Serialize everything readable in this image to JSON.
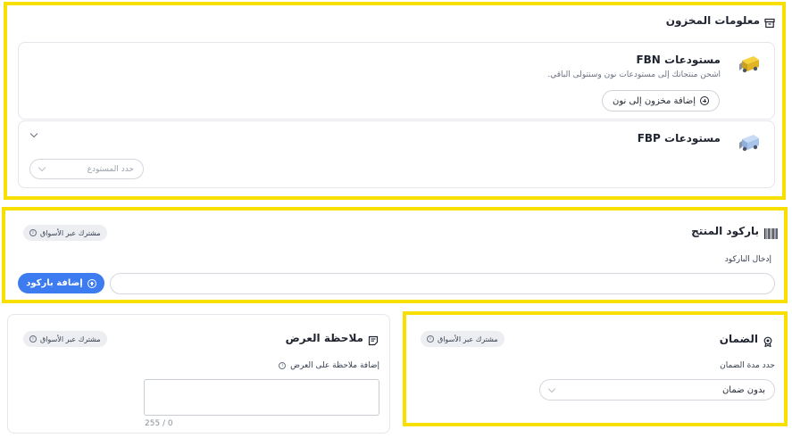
{
  "inventory": {
    "title": "معلومات المخزون",
    "fbn": {
      "title": "مستودعات FBN",
      "description": "اشحن منتجاتك إلى مستودعات نون وسنتولى الباقي.",
      "add_button": "إضافة مخزون إلى نون"
    },
    "fbp": {
      "title": "مستودعات FBP",
      "select_placeholder": "حدد المستودع"
    }
  },
  "barcode": {
    "title": "باركود المنتج",
    "shared_badge": "مشترك عبر الأسواق",
    "input_label": "إدخال الباركود",
    "add_button": "إضافة باركود"
  },
  "display_note": {
    "title": "ملاحظة العرض",
    "shared_badge": "مشترك عبر الأسواق",
    "field_label": "إضافة ملاحظة على العرض",
    "counter": "255 / 0"
  },
  "warranty": {
    "title": "الضمان",
    "shared_badge": "مشترك عبر الأسواق",
    "field_label": "حدد مدة الضمان",
    "selected_value": "بدون ضمان"
  },
  "colors": {
    "highlight": "#f7e000",
    "primary_button": "#3d7bf0"
  }
}
